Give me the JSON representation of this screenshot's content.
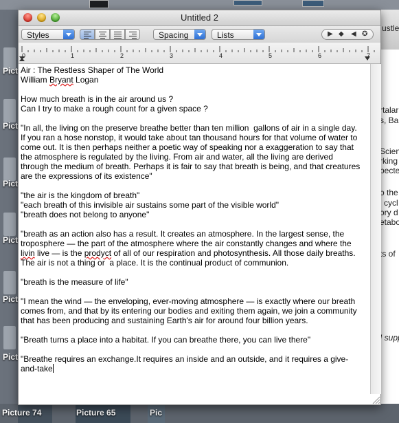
{
  "desktop": {
    "left_labels": [
      "Pict",
      "Pict",
      "Pict",
      "Pict",
      "Pict",
      "Pict",
      "Pict",
      "Pict",
      "Pic"
    ],
    "bottom_labels": [
      "Picture 74",
      "Picture 65",
      "Pic"
    ]
  },
  "background_window": {
    "lines": [
      "ustle",
      "rtalar",
      "s, Ba",
      "Scien",
      "rking",
      "pecte",
      "o the",
      "l cycl",
      "ory d",
      "etabo",
      "ts of",
      "I supp"
    ]
  },
  "window": {
    "title": "Untitled 2"
  },
  "toolbar": {
    "styles_label": "Styles",
    "spacing_label": "Spacing",
    "lists_label": "Lists",
    "nav_glyphs": [
      "▶",
      "◆",
      "◀",
      "✪"
    ]
  },
  "ruler": {
    "numbers": [
      "0",
      "1",
      "2",
      "3",
      "4",
      "5",
      "6",
      "7"
    ]
  },
  "document": {
    "line1": "Air : The Restless Shaper of The World",
    "line2a": "William ",
    "line2b": "Bryant",
    "line2c": " Logan",
    "line3": "How much breath is in the air around us ?",
    "line4": "Can I try to make a rough count for a given space ?",
    "p1": [
      "\"In all, the living on the preserve breathe better than ten million  gallons of air in a single day.",
      "If you ran a hose nonstop, it would take about tan thousand hours for that volume of water to",
      "come out. It is then perhaps neither a poetic way of speaking nor a exaggeration to say that",
      "the atmosphere is regulated by the living. From air and water, all the living are derived",
      "through the medium of breath. Perhaps it is fair to say that breath is being, and that creatures",
      "are the expressions of its existence\""
    ],
    "p2": [
      "\"the air is the kingdom of breath\"",
      "\"each breath of this invisible air sustains some part of the visible world\"",
      "\"breath does not belong to anyone\""
    ],
    "p3_line1": "\"breath as an action also has a result. It creates an atmosphere. In the largest sense, the",
    "p3_line2": "troposphere — the part of the atmosphere where the air constantly changes and where the",
    "p3_line3a": "livin",
    "p3_line3b": " live — is the ",
    "p3_line3c": "prodyct",
    "p3_line3d": " of all of our respiration and photosynthesis. All those daily breaths.",
    "p3_line4": "The air is not a thing or  a place. It is the continual product of communion.",
    "p4": "\"breath is the measure of life\"",
    "p5": [
      "\"I mean the wind — the enveloping, ever-moving atmosphere — is exactly where our breath",
      "comes from, and that by its entering our bodies and exiting them again, we join a community",
      "that has been producing and sustaining Earth's air for around four billion years."
    ],
    "p6": "\"Breath turns a place into a habitat. If you can breathe there, you can live there\"",
    "p7_line1": "\"Breathe requires an exchange.It requires an inside and an outside, and it requires a give-",
    "p7_line2": "and-take"
  }
}
